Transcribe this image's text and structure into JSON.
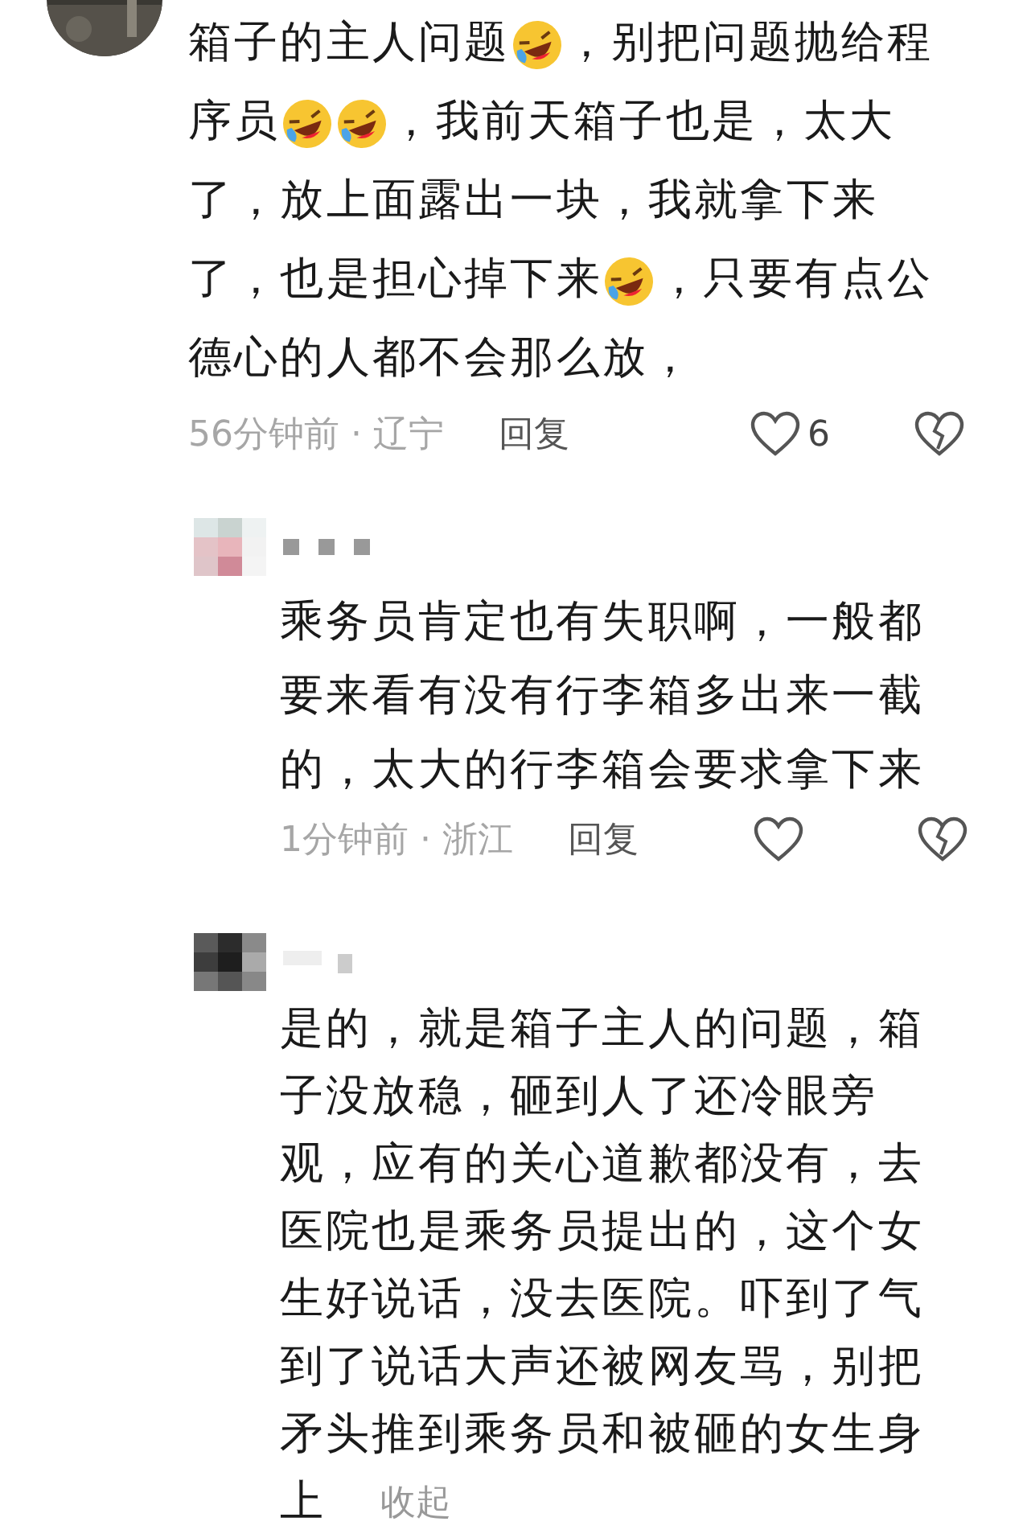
{
  "comments": [
    {
      "avatar": {
        "kind": "photo"
      },
      "lines": [
        [
          {
            "kind": "text",
            "text": "箱子的主人问题"
          },
          {
            "kind": "emoji"
          },
          {
            "kind": "text",
            "text": "，别把问题抛给程"
          }
        ],
        [
          {
            "kind": "text",
            "text": "序员"
          },
          {
            "kind": "emoji"
          },
          {
            "kind": "emoji"
          },
          {
            "kind": "text",
            "text": "，我前天箱子也是，太大"
          }
        ],
        [
          {
            "kind": "text",
            "text": "了，放上面露出一块，我就拿下来"
          }
        ],
        [
          {
            "kind": "text",
            "text": "了，也是担心掉下来"
          },
          {
            "kind": "emoji"
          },
          {
            "kind": "text",
            "text": "，只要有点公"
          }
        ],
        [
          {
            "kind": "text",
            "text": "德心的人都不会那么放，"
          }
        ]
      ],
      "meta": "56分钟前 · 辽宁",
      "reply_label": "回复",
      "likes": "6",
      "replies": [
        {
          "avatar": {
            "kind": "mosaic"
          },
          "lines": [
            [
              {
                "kind": "text",
                "text": "乘务员肯定也有失职啊，一般都"
              }
            ],
            [
              {
                "kind": "text",
                "text": "要来看有没有行李箱多出来一截"
              }
            ],
            [
              {
                "kind": "text",
                "text": "的，太大的行李箱会要求拿下来"
              }
            ]
          ],
          "meta": "1分钟前 · 浙江",
          "reply_label": "回复"
        },
        {
          "avatar": {
            "kind": "mosaic"
          },
          "lines": [
            [
              {
                "kind": "text",
                "text": "是的，就是箱子主人的问题，箱"
              }
            ],
            [
              {
                "kind": "text",
                "text": "子没放稳，砸到人了还冷眼旁"
              }
            ],
            [
              {
                "kind": "text",
                "text": "观，应有的关心道歉都没有，去"
              }
            ],
            [
              {
                "kind": "text",
                "text": "医院也是乘务员提出的，这个女"
              }
            ],
            [
              {
                "kind": "text",
                "text": "生好说话，没去医院。吓到了气"
              }
            ],
            [
              {
                "kind": "text",
                "text": "到了说话大声还被网友骂，别把"
              }
            ],
            [
              {
                "kind": "text",
                "text": "矛头推到乘务员和被砸的女生身"
              }
            ],
            [
              {
                "kind": "text",
                "text": "上"
              }
            ]
          ],
          "collapse_label": "收起"
        }
      ]
    }
  ]
}
